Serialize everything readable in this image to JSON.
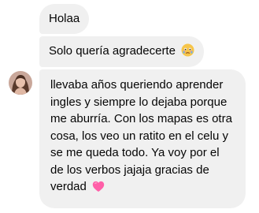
{
  "conversation": {
    "messages": [
      {
        "text": "Holaa"
      },
      {
        "text": "Solo quería agradecerte",
        "emoji": "crying-face-emoji"
      },
      {
        "lines": [
          "llevaba años queriendo aprender",
          "ingles y siempre lo dejaba porque",
          "me aburría. Con los mapas es otra",
          "cosa, los veo un ratito en el celu y",
          "se me queda todo. Ya voy por el",
          "de los verbos jajaja gracias de",
          "verdad"
        ],
        "emoji": "pink-heart-emoji"
      }
    ],
    "bubble_color": "#f0f0f0"
  }
}
